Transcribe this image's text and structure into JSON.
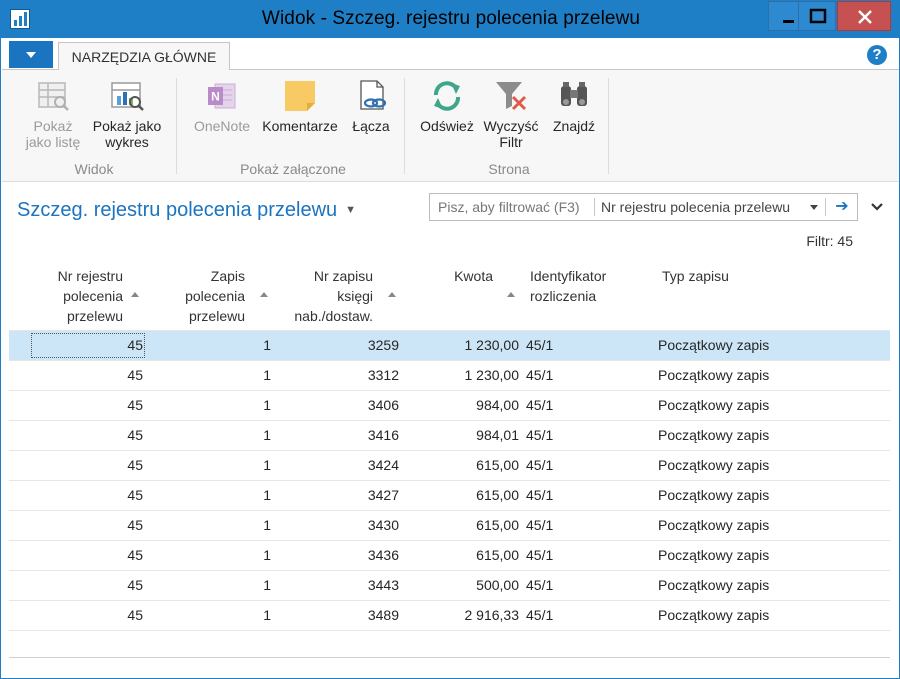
{
  "window": {
    "title": "Widok - Szczeg. rejestru polecenia przelewu",
    "minimize_glyph": "—",
    "maximize_glyph": "□",
    "close_glyph": "✕"
  },
  "ribbon": {
    "file_button_icon": "caret-down-icon",
    "tab_home": "NARZĘDZIA GŁÓWNE",
    "help_glyph": "?",
    "groups": {
      "widok": "Widok",
      "pokaz_zalaczone": "Pokaż załączone",
      "strona": "Strona"
    },
    "buttons": {
      "show_as_list_1": "Pokaż",
      "show_as_list_2": "jako listę",
      "show_as_chart_1": "Pokaż jako",
      "show_as_chart_2": "wykres",
      "onenote": "OneNote",
      "notes": "Komentarze",
      "links": "Łącza",
      "refresh": "Odśwież",
      "clear_filter_1": "Wyczyść",
      "clear_filter_2": "Filtr",
      "find": "Znajdź"
    }
  },
  "page": {
    "title": "Szczeg. rejestru polecenia przelewu",
    "filter_placeholder": "Pisz, aby filtrować (F3)",
    "filter_field": "Nr rejestru polecenia przelewu",
    "filter_go": "➔",
    "filter_status": "Filtr: 45"
  },
  "table": {
    "headers": {
      "reg_no": [
        "Nr rejestru",
        "polecenia",
        "przelewu"
      ],
      "entry": [
        "Zapis",
        "polecenia",
        "przelewu"
      ],
      "ledger": [
        "Nr zapisu",
        "księgi",
        "nab./dostaw."
      ],
      "amount": [
        "Kwota"
      ],
      "applies_id": [
        "Identyfikator",
        "rozliczenia"
      ],
      "entry_type": [
        "Typ zapisu"
      ]
    },
    "rows": [
      {
        "reg_no": "45",
        "entry": "1",
        "ledger": "3259",
        "amount": "1 230,00",
        "applies_id": "45/1",
        "entry_type": "Początkowy zapis"
      },
      {
        "reg_no": "45",
        "entry": "1",
        "ledger": "3312",
        "amount": "1 230,00",
        "applies_id": "45/1",
        "entry_type": "Początkowy zapis"
      },
      {
        "reg_no": "45",
        "entry": "1",
        "ledger": "3406",
        "amount": "984,00",
        "applies_id": "45/1",
        "entry_type": "Początkowy zapis"
      },
      {
        "reg_no": "45",
        "entry": "1",
        "ledger": "3416",
        "amount": "984,01",
        "applies_id": "45/1",
        "entry_type": "Początkowy zapis"
      },
      {
        "reg_no": "45",
        "entry": "1",
        "ledger": "3424",
        "amount": "615,00",
        "applies_id": "45/1",
        "entry_type": "Początkowy zapis"
      },
      {
        "reg_no": "45",
        "entry": "1",
        "ledger": "3427",
        "amount": "615,00",
        "applies_id": "45/1",
        "entry_type": "Początkowy zapis"
      },
      {
        "reg_no": "45",
        "entry": "1",
        "ledger": "3430",
        "amount": "615,00",
        "applies_id": "45/1",
        "entry_type": "Początkowy zapis"
      },
      {
        "reg_no": "45",
        "entry": "1",
        "ledger": "3436",
        "amount": "615,00",
        "applies_id": "45/1",
        "entry_type": "Początkowy zapis"
      },
      {
        "reg_no": "45",
        "entry": "1",
        "ledger": "3443",
        "amount": "500,00",
        "applies_id": "45/1",
        "entry_type": "Początkowy zapis"
      },
      {
        "reg_no": "45",
        "entry": "1",
        "ledger": "3489",
        "amount": "2 916,33",
        "applies_id": "45/1",
        "entry_type": "Początkowy zapis"
      }
    ]
  },
  "colors": {
    "accent": "#1f7fc6",
    "selected_row": "#cde6f7",
    "close_button": "#c75050"
  }
}
